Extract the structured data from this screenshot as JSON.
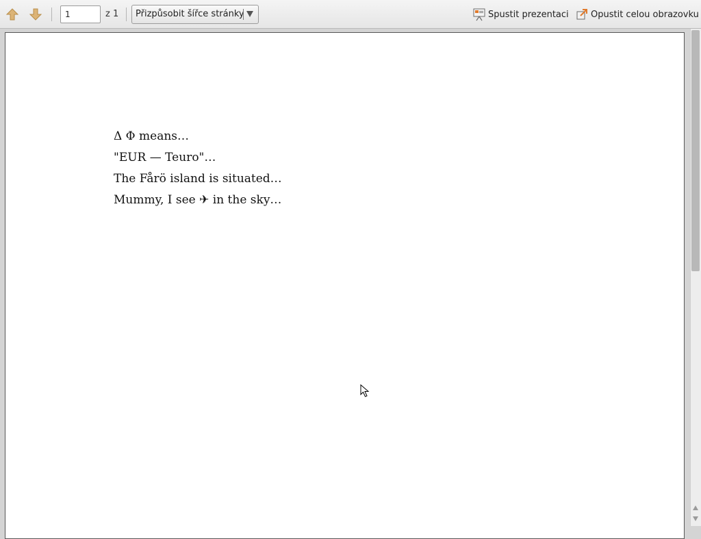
{
  "toolbar": {
    "prev_icon": "arrow-up-icon",
    "next_icon": "arrow-down-icon",
    "page_number": "1",
    "page_count": "z 1",
    "zoom_selected": "Přizpůsobit šířce stránky",
    "presentation_label": "Spustit prezentaci",
    "presentation_icon": "presentation-icon",
    "exit_fullscreen_label": "Opustit celou obrazovku",
    "exit_fullscreen_icon": "exit-fullscreen-icon"
  },
  "document": {
    "lines": [
      "Δ Φ means…",
      "\"EUR — Teuro\"…",
      "The Fårö island is situated…",
      "Mummy, I see ✈ in the sky…"
    ]
  },
  "colors": {
    "toolbar_bg": "#ececec",
    "arrow_icon": "#d9ad62",
    "page_bg": "#ffffff",
    "viewer_bg": "#d4d4d4"
  }
}
